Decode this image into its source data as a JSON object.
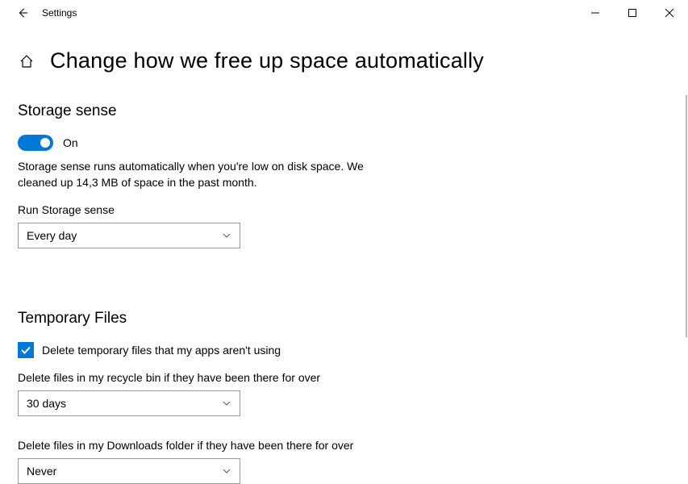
{
  "window": {
    "title": "Settings"
  },
  "page": {
    "title": "Change how we free up space automatically"
  },
  "storage_sense": {
    "heading": "Storage sense",
    "toggle_state": "On",
    "description": "Storage sense runs automatically when you're low on disk space. We cleaned up 14,3 MB of space in the past month.",
    "run_label": "Run Storage sense",
    "run_value": "Every day"
  },
  "temp_files": {
    "heading": "Temporary Files",
    "checkbox_label": "Delete temporary files that my apps aren't using",
    "recycle_label": "Delete files in my recycle bin if they have been there for over",
    "recycle_value": "30 days",
    "downloads_label": "Delete files in my Downloads folder if they have been there for over",
    "downloads_value": "Never"
  }
}
